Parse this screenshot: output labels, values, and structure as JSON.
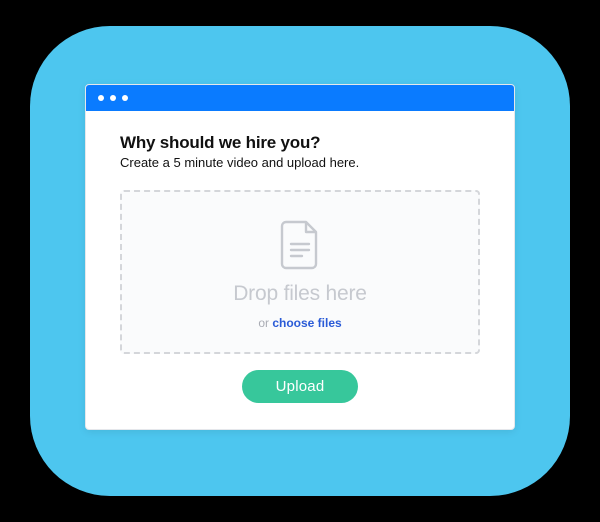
{
  "heading": "Why should we hire you?",
  "subheading": "Create a 5 minute video and upload here.",
  "dropzone": {
    "drop_text": "Drop files here",
    "or_text": "or ",
    "choose_text": "choose files"
  },
  "upload_label": "Upload"
}
